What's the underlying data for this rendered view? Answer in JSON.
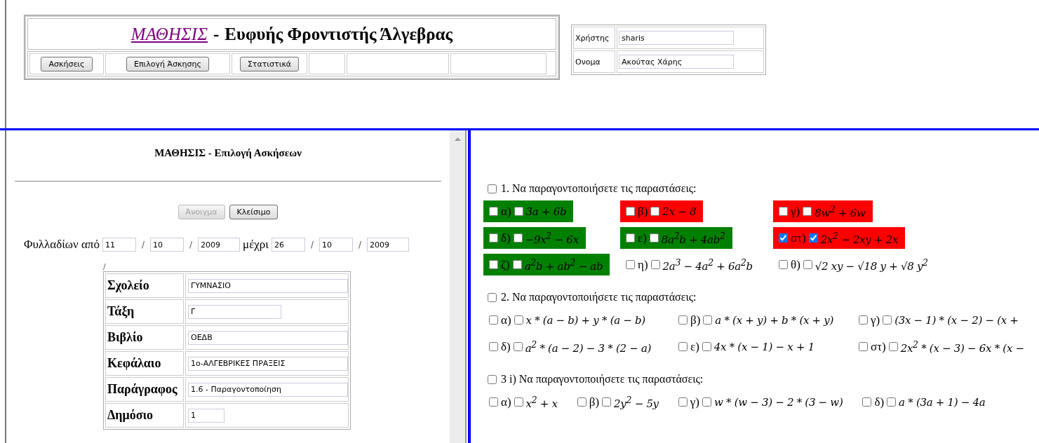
{
  "header": {
    "title_link": "ΜΑΘΗΣΙΣ",
    "separator": "-",
    "subtitle": "Ευφυής Φροντιστής Άλγεβρας",
    "nav_buttons": [
      "Ασκήσεις",
      "Επιλογή Άσκησης",
      "Στατιστικά"
    ]
  },
  "user": [
    {
      "label": "Χρήστης",
      "value": "sharis"
    },
    {
      "label": "Ονομα",
      "value": "Ακούτας Χάρης"
    }
  ],
  "left": {
    "title": "ΜΑΘΗΣΙΣ - Επιλογή Ασκήσεων",
    "buttons": [
      {
        "label": "Άνοιγμα",
        "disabled": true
      },
      {
        "label": "Κλείσιμο",
        "disabled": false
      }
    ],
    "date_filter": [
      {
        "kind": "text",
        "text": "Φυλλαδίων από"
      },
      {
        "kind": "field",
        "value": "11"
      },
      {
        "kind": "sep",
        "text": "/"
      },
      {
        "kind": "field",
        "value": "10"
      },
      {
        "kind": "sep",
        "text": "/"
      },
      {
        "kind": "field",
        "value": "2009"
      },
      {
        "kind": "text",
        "text": "μέχρι"
      },
      {
        "kind": "field",
        "value": "26"
      },
      {
        "kind": "sep",
        "text": "/"
      },
      {
        "kind": "field",
        "value": "10"
      },
      {
        "kind": "sep",
        "text": "/"
      },
      {
        "kind": "field",
        "value": "2009"
      }
    ],
    "stray_mark": "/",
    "details": [
      {
        "label": "Σχολείο",
        "value": "ΓΥΜΝΑΣΙΟ",
        "kind": "wide"
      },
      {
        "label": "Τάξη",
        "value": "Γ",
        "kind": "medium"
      },
      {
        "label": "Βιβλίο",
        "value": "ΟΕΔΒ",
        "kind": "wide"
      },
      {
        "label": "Κεφάλαιο",
        "value": "1ο-ΑΛΓΕΒΡΙΚΕΣ ΠΡΑΞΕΙΣ",
        "kind": "wide"
      },
      {
        "label": "Παράγραφος",
        "value": "1.6 - Παραγοντοποίηση",
        "kind": "wide"
      },
      {
        "label": "Δημόσιο",
        "value": "1",
        "kind": "small"
      }
    ]
  },
  "exercises": [
    {
      "title": "1. Να παραγοντοποιήσετε τις παραστάσεις:",
      "checked": false,
      "rows": [
        [
          {
            "label": "α)",
            "expr": "3a + 6b",
            "checked": false,
            "color": "#008000"
          },
          {
            "label": "β)",
            "expr": "2x − 8",
            "checked": false,
            "color": "#ff0000"
          },
          {
            "label": "γ)",
            "expr": "8w$^{2}$ + 6w",
            "checked": false,
            "color": "#ff0000"
          }
        ],
        [
          {
            "label": "δ)",
            "expr": "−9x$^{2}$ − 6x",
            "checked": false,
            "color": "#008000"
          },
          {
            "label": "ε)",
            "expr": "8a$^{2}$b + 4ab$^{2}$",
            "checked": false,
            "color": "#008000"
          },
          {
            "label": "στ)",
            "expr": "2x$^{2}$ − 2xy + 2x",
            "checked": true,
            "color": "#ff0000"
          }
        ],
        [
          {
            "label": "ζ)",
            "expr": "a$^{2}$b + ab$^{2}$ − ab",
            "checked": false,
            "color": "#008000"
          },
          {
            "label": "η)",
            "expr": "2a$^{3}$ − 4a$^{2}$ + 6a$^{2}$b",
            "checked": false
          },
          {
            "label": "θ)",
            "expr": "√2 xy − √18 y + √8 y$^{2}$",
            "checked": false
          }
        ]
      ]
    },
    {
      "title": "2. Να παραγοντοποιήσετε τις παραστάσεις:",
      "checked": false,
      "rows": [
        [
          {
            "label": "α)",
            "expr": "x * (a − b) + y * (a − b)",
            "checked": false
          },
          {
            "label": "β)",
            "expr": "a * (x + y) + b * (x + y)",
            "checked": false
          },
          {
            "label": "γ)",
            "expr": "(3x − 1) * (x − 2) − (x +",
            "checked": false
          }
        ],
        [
          {
            "label": "δ)",
            "expr": "a$^{2}$ * (a − 2) − 3 * (2 − a)",
            "checked": false
          },
          {
            "label": "ε)",
            "expr": "4x * (x − 1) − x + 1",
            "checked": false
          },
          {
            "label": "στ)",
            "expr": "2x$^{2}$ * (x − 3) − 6x * (x −",
            "checked": false
          }
        ]
      ]
    },
    {
      "title": "3 i) Να παραγοντοποιήσετε τις παραστάσεις:",
      "checked": false,
      "rows": [
        [
          {
            "label": "α)",
            "expr": "x$^{2}$ + x",
            "checked": false
          },
          {
            "label": "β)",
            "expr": "2y$^{2}$ − 5y",
            "checked": false
          },
          {
            "label": "γ)",
            "expr": "w * (w − 3) − 2 * (3 − w)",
            "checked": false
          },
          {
            "label": "δ)",
            "expr": "a * (3a + 1) − 4a",
            "checked": false
          }
        ]
      ]
    }
  ]
}
